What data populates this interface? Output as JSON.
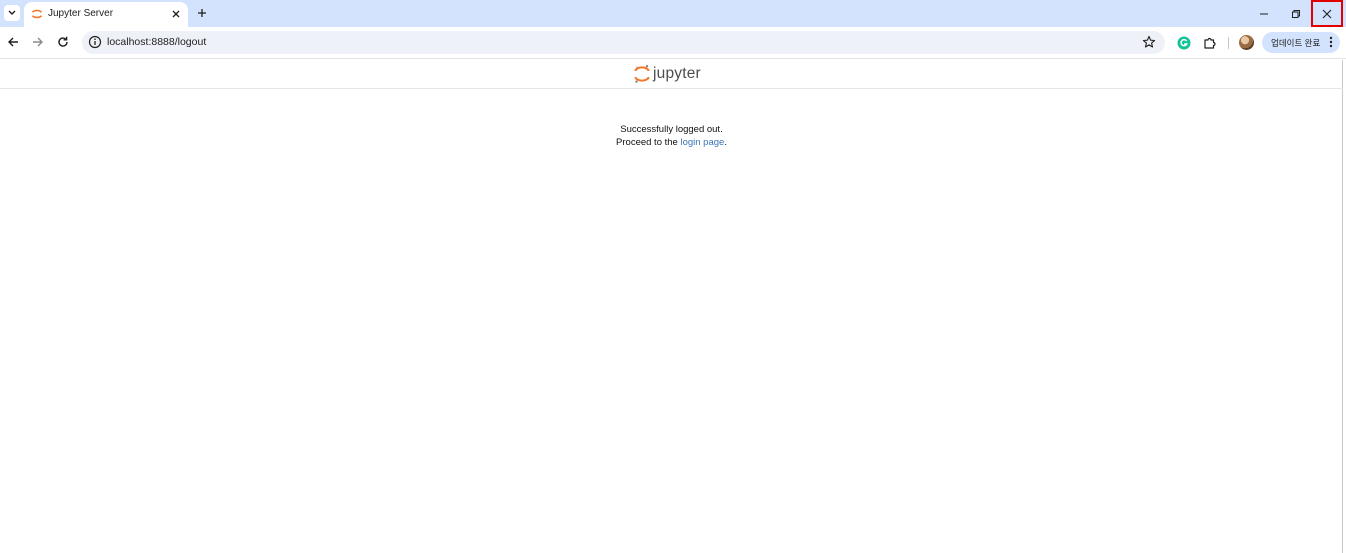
{
  "browser": {
    "tab": {
      "title": "Jupyter Server",
      "favicon": "jupyter-icon"
    },
    "address_bar": {
      "url": "localhost:8888/logout"
    },
    "toolbar": {
      "update_label": "업데이트 완료"
    },
    "icons": {
      "tab_search": "chevron-down-icon",
      "tab_close": "close-icon",
      "new_tab": "plus-icon",
      "minimize": "minimize-icon",
      "restore": "restore-icon",
      "close": "close-icon",
      "back": "arrow-left-icon",
      "forward": "arrow-right-icon",
      "reload": "reload-icon",
      "site_info": "info-icon",
      "bookmark": "star-icon",
      "grammarly": "grammarly-icon",
      "extensions": "puzzle-icon",
      "menu": "more-vert-icon"
    },
    "colors": {
      "tabstrip": "#d3e3fd",
      "close_highlight": "#e00000"
    }
  },
  "page": {
    "logo_text": "jupyter",
    "message_line1": "Successfully logged out.",
    "message_line2_prefix": "Proceed to the ",
    "login_link": "login page",
    "message_line2_suffix": ".",
    "colors": {
      "link": "#3b74b8",
      "logo_orange": "#f37726"
    }
  }
}
